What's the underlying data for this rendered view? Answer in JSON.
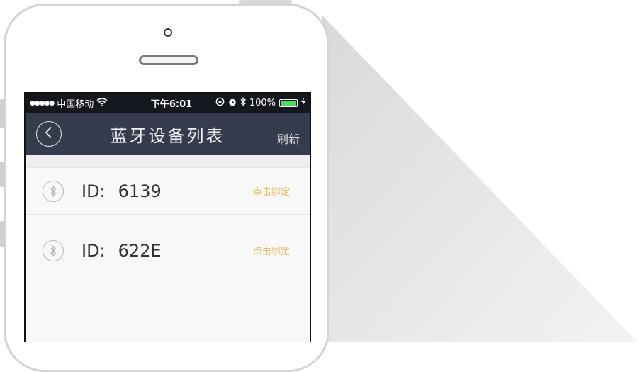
{
  "status_bar": {
    "signal": "●●●●●",
    "carrier": "中国移动",
    "time": "下午6:01",
    "battery": "100%",
    "battery_level": 1.0
  },
  "navbar": {
    "title": "蓝牙设备列表",
    "refresh_label": "刷新"
  },
  "devices": [
    {
      "id_label": "ID:",
      "id_value": "6139",
      "action": "点击绑定"
    },
    {
      "id_label": "ID:",
      "id_value": "622E",
      "action": "点击绑定"
    }
  ],
  "colors": {
    "navbar_bg": "#353c4d",
    "statusbar_bg": "#14171d",
    "action_accent": "#f2b95a",
    "battery_green": "#4cd964"
  }
}
